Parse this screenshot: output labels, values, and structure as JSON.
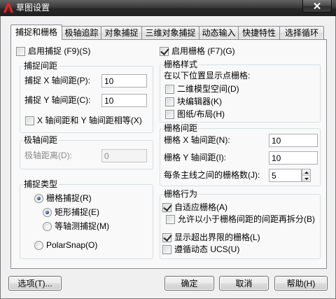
{
  "window": {
    "title": "草图设置"
  },
  "icons": {
    "app": "autocad-logo-icon",
    "close": "close-icon",
    "spinner_up": "chevron-up-icon",
    "spinner_down": "chevron-down-icon"
  },
  "colors": {
    "titlebar": "#2f2f2f",
    "panel": "#f9f9f9",
    "tab_border": "#898c95",
    "group_border": "#d5dfe5",
    "check_mark": "#252525",
    "radio_dot": "#234a8a",
    "disabled_text": "#8a8a8a",
    "app_icon": "#e3262b"
  },
  "tabs": [
    {
      "label": "捕捉和栅格",
      "active": true
    },
    {
      "label": "极轴追踪",
      "active": false
    },
    {
      "label": "对象捕捉",
      "active": false
    },
    {
      "label": "三维对象捕捉",
      "active": false
    },
    {
      "label": "动态输入",
      "active": false
    },
    {
      "label": "快捷特性",
      "active": false
    },
    {
      "label": "选择循环",
      "active": false
    }
  ],
  "snap": {
    "enable": {
      "label": "启用捕捉 (F9)(S)",
      "checked": false
    },
    "spacing": {
      "title": "捕捉间距",
      "x_label": "捕捉 X 轴间距(P):",
      "x_value": "10",
      "y_label": "捕捉 Y 轴间距(C):",
      "y_value": "10",
      "equal": {
        "label": "X 轴间距和 Y 轴间距相等(X)",
        "checked": false
      }
    },
    "polar": {
      "title": "极轴间距",
      "distance_label": "极轴距离(D):",
      "distance_value": "0",
      "disabled": true
    },
    "type": {
      "title": "捕捉类型",
      "grid_snap": {
        "label": "栅格捕捉(R)",
        "checked": true
      },
      "rectangular": {
        "label": "矩形捕捉(E)",
        "checked": true
      },
      "isometric": {
        "label": "等轴测捕捉(M)",
        "checked": false
      },
      "polar_snap": {
        "label": "PolarSnap(O)",
        "checked": false
      }
    }
  },
  "grid": {
    "enable": {
      "label": "启用栅格 (F7)(G)",
      "checked": true
    },
    "style": {
      "title": "栅格样式",
      "caption": "在以下位置显示点栅格:",
      "model_space_2d": {
        "label": "二维模型空间(D)",
        "checked": false
      },
      "block_editor": {
        "label": "块编辑器(K)",
        "checked": false
      },
      "sheet_layout": {
        "label": "图纸/布局(H)",
        "checked": false
      }
    },
    "spacing": {
      "title": "栅格间距",
      "x_label": "栅格 X 轴间距(N):",
      "x_value": "10",
      "y_label": "栅格 Y 轴间距(I):",
      "y_value": "10",
      "major_label": "每条主线之间的栅格数(J):",
      "major_value": "5"
    },
    "behavior": {
      "title": "栅格行为",
      "adaptive": {
        "label": "自适应栅格(A)",
        "checked": true
      },
      "subdivide": {
        "label": "允许以小于栅格间距的间距再拆分(B)",
        "checked": false
      },
      "beyond_limits": {
        "label": "显示超出界限的栅格(L)",
        "checked": true
      },
      "dynamic_ucs": {
        "label": "遵循动态 UCS(U)",
        "checked": false
      }
    }
  },
  "buttons": {
    "options": "选项(T)...",
    "ok": "确定",
    "cancel": "取消",
    "help": "帮助(H)"
  }
}
